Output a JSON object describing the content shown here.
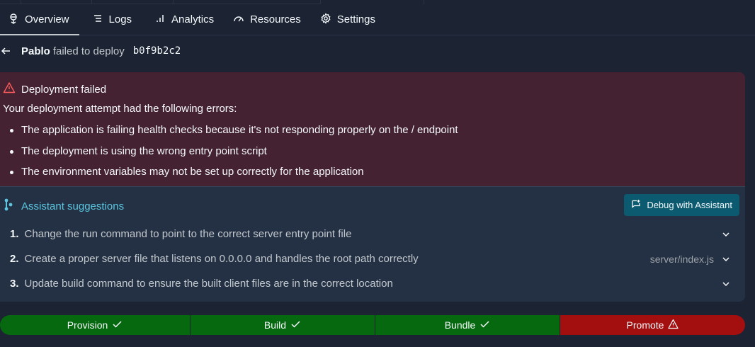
{
  "tabs": [
    {
      "label": "Overview",
      "icon": "deployment-icon",
      "active": true
    },
    {
      "label": "Logs",
      "icon": "list-icon"
    },
    {
      "label": "Analytics",
      "icon": "bar-chart-icon"
    },
    {
      "label": "Resources",
      "icon": "gauge-icon"
    },
    {
      "label": "Settings",
      "icon": "gear-icon"
    }
  ],
  "breadcrumb": {
    "author": "Pablo",
    "verb": "failed to deploy",
    "sha": "b0f9b2c2"
  },
  "error": {
    "title": "Deployment failed",
    "intro": "Your deployment attempt had the following errors:",
    "items": [
      "The application is failing health checks because it's not responding properly on the / endpoint",
      "The deployment is using the wrong entry point script",
      "The environment variables may not be set up correctly for the application"
    ]
  },
  "assistant": {
    "title": "Assistant suggestions",
    "debug_label": "Debug with Assistant",
    "steps": [
      {
        "num": "1.",
        "text": "Change the run command to point to the correct server entry point file",
        "file": ""
      },
      {
        "num": "2.",
        "text": "Create a proper server file that listens on 0.0.0.0 and handles the root path correctly",
        "file": "server/index.js"
      },
      {
        "num": "3.",
        "text": "Update build command to ensure the built client files are in the correct location",
        "file": ""
      }
    ]
  },
  "pipeline": [
    {
      "label": "Provision",
      "status": "success"
    },
    {
      "label": "Build",
      "status": "success"
    },
    {
      "label": "Bundle",
      "status": "success"
    },
    {
      "label": "Promote",
      "status": "failed"
    }
  ],
  "colors": {
    "background": "#1c2333",
    "error_bg": "#452231",
    "assistant_bg": "#243145",
    "accent": "#5bc6e0",
    "success": "#06690f",
    "failure": "#a30e0e"
  }
}
